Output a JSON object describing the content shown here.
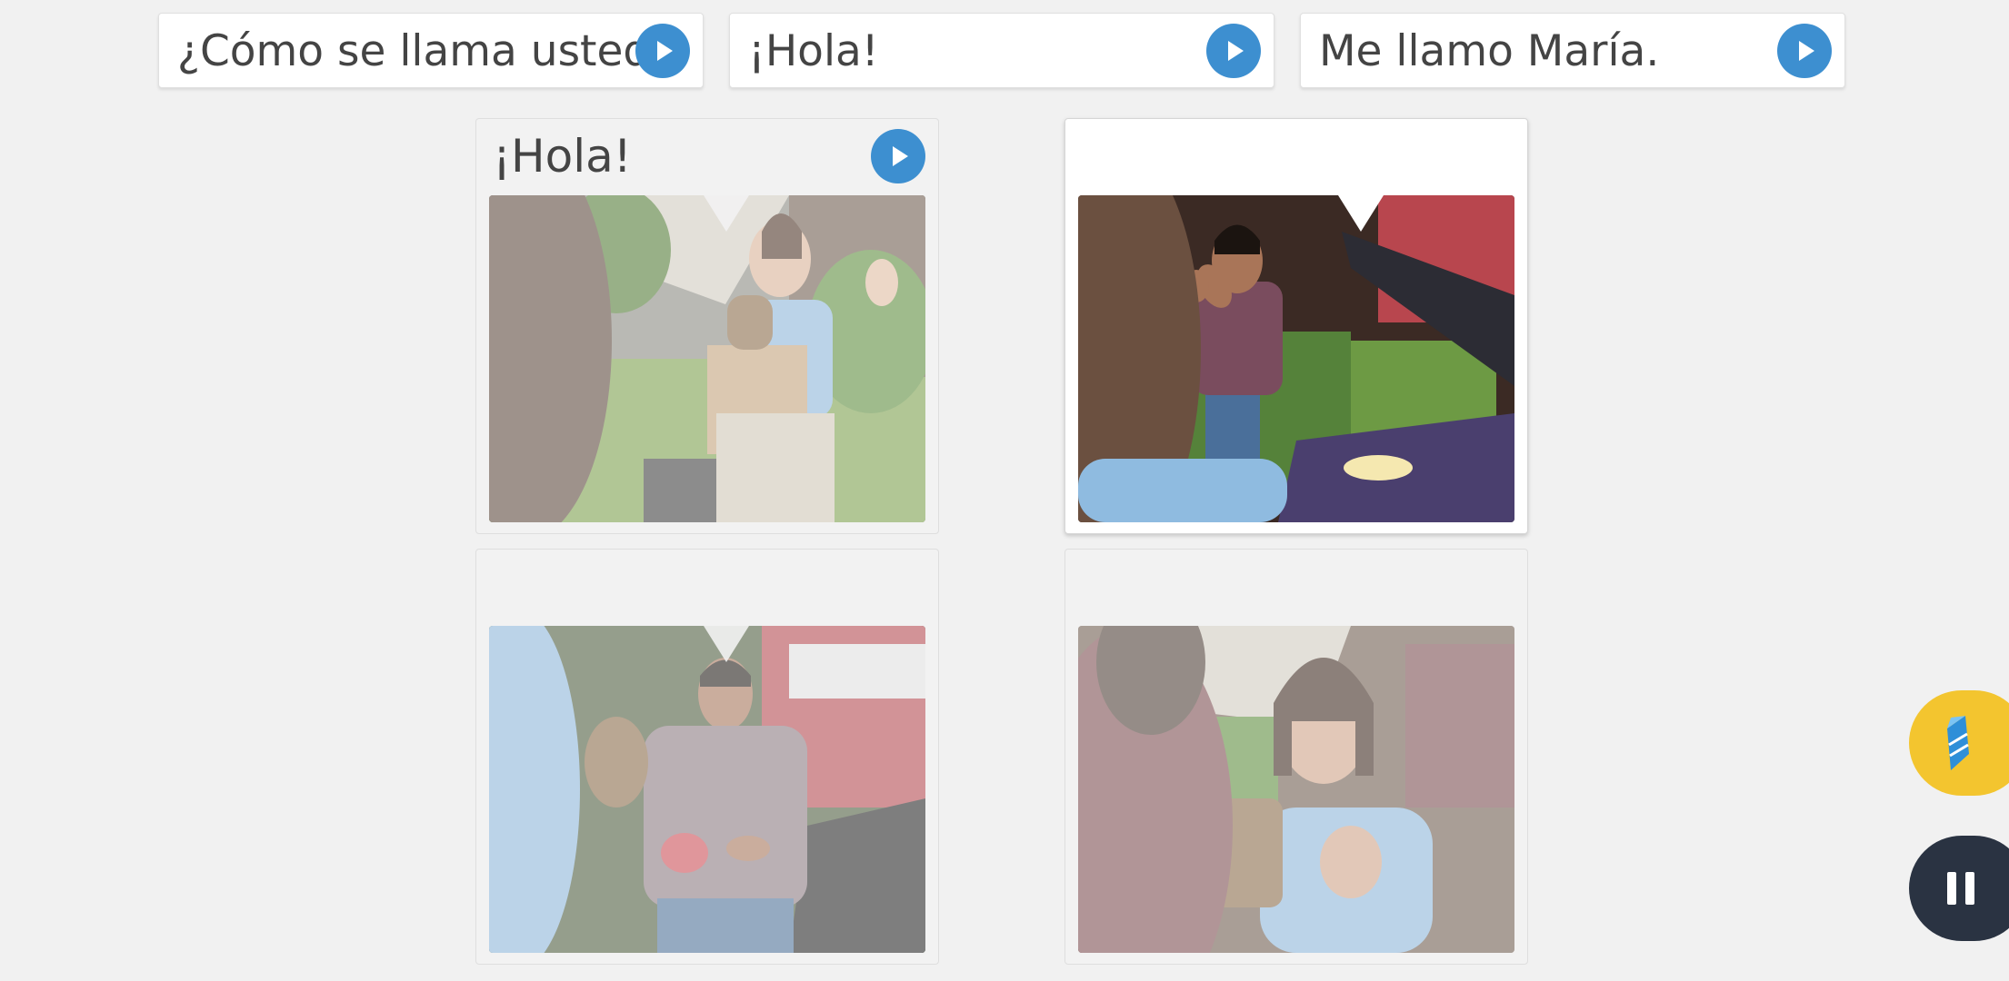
{
  "phrases": [
    {
      "text": "¿Cómo se llama usted?"
    },
    {
      "text": "¡Hola!"
    },
    {
      "text": "Me llamo María."
    }
  ],
  "cards": [
    {
      "caption": "¡Hola!",
      "state": "answered",
      "scene": "woman waving holding box and basket"
    },
    {
      "caption": "",
      "state": "active",
      "scene": "man waving next to car with open hood"
    },
    {
      "caption": "",
      "state": "inactive",
      "scene": "man holding red cloth talking"
    },
    {
      "caption": "",
      "state": "inactive",
      "scene": "woman with hand on chest smiling"
    }
  ],
  "colors": {
    "background": "#f1f1f1",
    "play_button": "#3d8fd0",
    "brand_button": "#f3c52f",
    "pause_button": "#2a3342"
  },
  "icons": {
    "play": "play-icon",
    "brand": "rosetta-stone-logo-icon",
    "pause": "pause-icon"
  }
}
